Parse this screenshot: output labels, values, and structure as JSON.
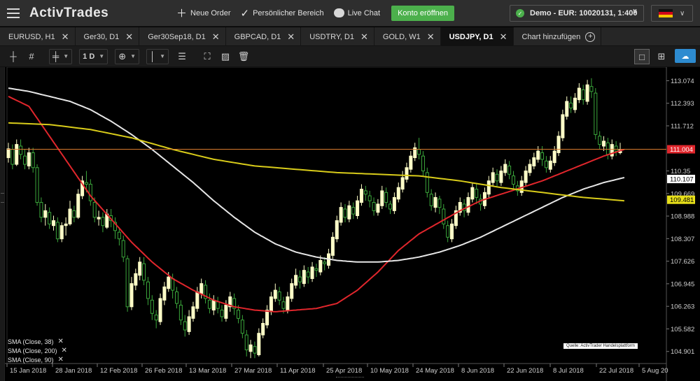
{
  "header": {
    "logo": "ActivTrades",
    "new_order": "Neue Order",
    "personal_area": "Persönlicher Bereich",
    "live_chat": "Live Chat",
    "open_account": "Konto eröffnen",
    "account": "Demo - EUR: 10020131, 1:400"
  },
  "tabs": [
    {
      "label": "EURUSD, H1"
    },
    {
      "label": "Ger30, D1"
    },
    {
      "label": "Ger30Sep18, D1"
    },
    {
      "label": "GBPCAD, D1"
    },
    {
      "label": "USDTRY, D1"
    },
    {
      "label": "GOLD, W1"
    },
    {
      "label": "USDJPY, D1"
    }
  ],
  "add_chart": "Chart hinzufügen",
  "toolbar": {
    "timeframe": "1 D"
  },
  "legend": [
    {
      "label": "SMA (Close, 38)"
    },
    {
      "label": "SMA (Close, 200)"
    },
    {
      "label": "SMA (Close, 90)"
    }
  ],
  "source": "Quelle: ActivTrader Handelsplattform",
  "colors": {
    "up": "#ffffc8",
    "down": "#3ba73b",
    "sma38": "#e0262c",
    "sma200": "#e6e6e6",
    "sma90": "#d9cc1a",
    "price_line": "#d97b2e",
    "accent": "#4cb04c"
  },
  "chart_data": {
    "type": "candlestick",
    "symbol": "USDJPY",
    "timeframe": "D1",
    "y_ticks": [
      104.901,
      105.582,
      106.263,
      106.945,
      107.626,
      108.307,
      108.988,
      109.669,
      110.35,
      111.712,
      112.393,
      113.074
    ],
    "ylim": [
      104.6,
      113.4
    ],
    "x_ticks": [
      "15 Jan 2018",
      "28 Jan 2018",
      "12 Feb 2018",
      "26 Feb 2018",
      "13 Mar 2018",
      "27 Mar 2018",
      "11 Apr 2018",
      "25 Apr 2018",
      "10 May 2018",
      "24 May 2018",
      "8 Jun 2018",
      "22 Jun 2018",
      "8 Jul 2018",
      "22 Jul 2018",
      "5 Aug 20"
    ],
    "price_labels": [
      {
        "value": 111.004,
        "text": "111.004",
        "color": "#e0262c"
      },
      {
        "value": 110.107,
        "text": "110.107",
        "color": "#ffffff"
      },
      {
        "value": 109.481,
        "text": "109.481",
        "color": "#e8e01a"
      }
    ],
    "last_price": 111.004,
    "candles": [
      [
        110.75,
        111.02,
        110.6,
        111.2
      ],
      [
        111.0,
        110.55,
        110.4,
        111.15
      ],
      [
        110.55,
        111.15,
        110.5,
        111.3
      ],
      [
        111.1,
        110.85,
        110.7,
        111.3
      ],
      [
        110.8,
        110.55,
        110.4,
        111.0
      ],
      [
        110.5,
        110.9,
        110.4,
        111.05
      ],
      [
        110.9,
        110.45,
        110.3,
        111.05
      ],
      [
        110.45,
        109.4,
        109.3,
        110.55
      ],
      [
        109.4,
        108.95,
        108.8,
        109.55
      ],
      [
        108.95,
        109.15,
        108.7,
        109.35
      ],
      [
        109.1,
        108.75,
        108.6,
        109.25
      ],
      [
        108.7,
        108.85,
        108.55,
        109.0
      ],
      [
        108.8,
        108.3,
        108.2,
        108.95
      ],
      [
        108.3,
        108.7,
        108.2,
        108.8
      ],
      [
        108.7,
        108.75,
        108.4,
        108.95
      ],
      [
        108.75,
        109.2,
        108.7,
        109.45
      ],
      [
        109.15,
        108.95,
        108.8,
        109.3
      ],
      [
        108.95,
        109.65,
        108.9,
        109.8
      ],
      [
        109.6,
        110.05,
        109.5,
        110.2
      ],
      [
        110.0,
        109.95,
        109.7,
        110.35
      ],
      [
        109.95,
        109.45,
        109.3,
        110.1
      ],
      [
        109.4,
        108.95,
        108.8,
        109.55
      ],
      [
        108.9,
        108.95,
        108.7,
        109.15
      ],
      [
        108.95,
        108.7,
        108.5,
        109.1
      ],
      [
        108.65,
        109.05,
        108.6,
        109.2
      ],
      [
        109.0,
        108.85,
        108.65,
        109.2
      ],
      [
        108.8,
        108.55,
        108.3,
        108.95
      ],
      [
        108.5,
        108.3,
        108.1,
        108.65
      ],
      [
        108.25,
        107.75,
        107.6,
        108.4
      ],
      [
        107.7,
        106.25,
        106.1,
        107.8
      ],
      [
        106.25,
        106.95,
        106.15,
        107.15
      ],
      [
        106.9,
        107.25,
        106.75,
        107.4
      ],
      [
        107.2,
        107.6,
        107.05,
        107.75
      ],
      [
        107.55,
        107.05,
        106.9,
        107.75
      ],
      [
        107.0,
        106.5,
        106.3,
        107.15
      ],
      [
        106.45,
        106.05,
        105.85,
        106.6
      ],
      [
        106.0,
        105.85,
        105.6,
        106.15
      ],
      [
        105.8,
        106.5,
        105.7,
        106.65
      ],
      [
        106.45,
        106.85,
        106.3,
        107.0
      ],
      [
        106.8,
        107.15,
        106.7,
        107.3
      ],
      [
        107.1,
        106.75,
        106.5,
        107.25
      ],
      [
        106.7,
        106.35,
        106.2,
        106.85
      ],
      [
        106.3,
        105.85,
        105.7,
        106.45
      ],
      [
        105.8,
        105.55,
        105.35,
        106.0
      ],
      [
        105.5,
        105.95,
        105.4,
        106.15
      ],
      [
        105.9,
        106.25,
        105.8,
        106.4
      ],
      [
        106.2,
        106.7,
        106.1,
        106.85
      ],
      [
        106.65,
        106.95,
        106.5,
        107.1
      ],
      [
        106.9,
        106.5,
        106.35,
        107.05
      ],
      [
        106.45,
        106.2,
        106.05,
        106.65
      ],
      [
        106.15,
        106.45,
        106.0,
        106.6
      ],
      [
        106.4,
        106.2,
        106.05,
        106.55
      ],
      [
        106.15,
        105.95,
        105.8,
        106.3
      ],
      [
        105.9,
        106.3,
        105.8,
        106.45
      ],
      [
        106.25,
        106.55,
        106.1,
        106.7
      ],
      [
        106.5,
        106.2,
        106.0,
        106.65
      ],
      [
        106.15,
        105.9,
        105.75,
        106.3
      ],
      [
        105.85,
        105.45,
        105.3,
        106.0
      ],
      [
        105.4,
        104.95,
        104.75,
        105.55
      ],
      [
        104.9,
        105.1,
        104.7,
        105.25
      ],
      [
        105.05,
        104.85,
        104.7,
        105.2
      ],
      [
        104.8,
        105.45,
        104.75,
        105.6
      ],
      [
        105.4,
        105.75,
        105.3,
        105.9
      ],
      [
        105.7,
        106.15,
        105.6,
        106.3
      ],
      [
        106.1,
        106.55,
        106.0,
        106.7
      ],
      [
        106.5,
        106.75,
        106.4,
        106.95
      ],
      [
        106.7,
        106.45,
        106.3,
        106.85
      ],
      [
        106.4,
        106.2,
        106.05,
        106.55
      ],
      [
        106.15,
        106.55,
        106.05,
        106.7
      ],
      [
        106.5,
        106.95,
        106.4,
        107.1
      ],
      [
        106.9,
        107.2,
        106.8,
        107.4
      ],
      [
        107.15,
        107.0,
        106.8,
        107.35
      ],
      [
        106.95,
        107.35,
        106.85,
        107.5
      ],
      [
        107.3,
        107.15,
        106.95,
        107.45
      ],
      [
        107.1,
        107.45,
        107.0,
        107.6
      ],
      [
        107.4,
        107.35,
        107.15,
        107.55
      ],
      [
        107.3,
        107.65,
        107.2,
        107.8
      ],
      [
        107.6,
        107.55,
        107.35,
        107.75
      ],
      [
        107.5,
        107.85,
        107.4,
        108.0
      ],
      [
        107.8,
        108.35,
        107.7,
        108.5
      ],
      [
        108.3,
        108.85,
        108.2,
        109.0
      ],
      [
        108.8,
        109.25,
        108.7,
        109.4
      ],
      [
        109.2,
        108.95,
        108.8,
        109.35
      ],
      [
        108.9,
        109.3,
        108.8,
        109.45
      ],
      [
        109.25,
        109.05,
        108.9,
        109.4
      ],
      [
        109.0,
        109.45,
        108.9,
        109.6
      ],
      [
        109.4,
        109.8,
        109.3,
        109.95
      ],
      [
        109.75,
        109.65,
        109.45,
        109.9
      ],
      [
        109.6,
        109.45,
        109.25,
        109.75
      ],
      [
        109.4,
        109.15,
        109.0,
        109.55
      ],
      [
        109.1,
        109.35,
        109.0,
        109.5
      ],
      [
        109.3,
        109.75,
        109.2,
        109.9
      ],
      [
        109.7,
        109.4,
        109.25,
        109.85
      ],
      [
        109.35,
        109.2,
        109.05,
        109.45
      ],
      [
        109.15,
        109.55,
        109.05,
        109.7
      ],
      [
        109.5,
        109.85,
        109.4,
        110.0
      ],
      [
        109.8,
        110.15,
        109.7,
        110.35
      ],
      [
        110.1,
        110.45,
        110.0,
        110.6
      ],
      [
        110.4,
        110.8,
        110.3,
        110.95
      ],
      [
        110.75,
        111.05,
        110.65,
        111.2
      ],
      [
        111.0,
        110.85,
        110.7,
        111.35
      ],
      [
        110.8,
        110.35,
        110.2,
        110.95
      ],
      [
        110.3,
        109.7,
        109.55,
        110.45
      ],
      [
        109.65,
        109.3,
        109.15,
        109.8
      ],
      [
        109.25,
        109.55,
        109.1,
        109.7
      ],
      [
        109.5,
        109.25,
        109.05,
        109.6
      ],
      [
        109.2,
        108.75,
        108.6,
        109.35
      ],
      [
        108.7,
        108.35,
        108.2,
        108.85
      ],
      [
        108.3,
        108.75,
        108.2,
        108.9
      ],
      [
        108.7,
        109.15,
        108.6,
        109.3
      ],
      [
        109.1,
        109.4,
        109.0,
        109.55
      ],
      [
        109.35,
        109.15,
        108.95,
        109.5
      ],
      [
        109.1,
        109.55,
        109.0,
        109.7
      ],
      [
        109.5,
        109.85,
        109.4,
        110.0
      ],
      [
        109.8,
        109.55,
        109.35,
        109.95
      ],
      [
        109.5,
        109.35,
        109.15,
        109.65
      ],
      [
        109.3,
        109.7,
        109.2,
        109.85
      ],
      [
        109.65,
        110.05,
        109.55,
        110.2
      ],
      [
        110.0,
        110.3,
        109.9,
        110.45
      ],
      [
        110.25,
        110.05,
        109.85,
        110.4
      ],
      [
        110.0,
        110.35,
        109.9,
        110.5
      ],
      [
        110.3,
        110.55,
        110.2,
        110.7
      ],
      [
        110.5,
        110.25,
        110.1,
        110.65
      ],
      [
        110.2,
        109.95,
        109.75,
        110.35
      ],
      [
        109.9,
        109.75,
        109.6,
        110.05
      ],
      [
        109.7,
        110.05,
        109.6,
        110.2
      ],
      [
        110.0,
        110.35,
        109.9,
        110.5
      ],
      [
        110.3,
        110.55,
        110.2,
        110.7
      ],
      [
        110.5,
        110.75,
        110.4,
        110.9
      ],
      [
        110.7,
        110.95,
        110.6,
        111.1
      ],
      [
        110.9,
        110.7,
        110.5,
        111.1
      ],
      [
        110.65,
        110.45,
        110.3,
        110.8
      ],
      [
        110.4,
        110.65,
        110.3,
        110.8
      ],
      [
        110.6,
        110.95,
        110.5,
        111.1
      ],
      [
        110.9,
        111.4,
        110.8,
        111.55
      ],
      [
        111.35,
        112.05,
        111.25,
        112.2
      ],
      [
        112.0,
        112.45,
        111.9,
        112.6
      ],
      [
        112.4,
        112.25,
        112.1,
        112.6
      ],
      [
        112.2,
        112.55,
        112.1,
        112.7
      ],
      [
        112.5,
        112.85,
        112.4,
        113.0
      ],
      [
        112.8,
        112.5,
        112.35,
        112.95
      ],
      [
        112.45,
        112.95,
        112.35,
        113.1
      ],
      [
        112.9,
        112.75,
        112.55,
        113.15
      ],
      [
        112.7,
        111.45,
        111.3,
        112.85
      ],
      [
        111.4,
        111.15,
        111.0,
        111.55
      ],
      [
        111.1,
        111.25,
        110.95,
        111.4
      ],
      [
        111.2,
        110.85,
        110.7,
        111.35
      ],
      [
        110.8,
        111.15,
        110.7,
        111.3
      ],
      [
        111.1,
        110.95,
        110.8,
        111.25
      ],
      [
        110.9,
        111.0,
        110.85,
        111.2
      ]
    ],
    "series": [
      {
        "name": "SMA (Close, 38)",
        "color": "#e0262c",
        "points": [
          [
            0,
            112.6
          ],
          [
            5,
            112.3
          ],
          [
            10,
            111.4
          ],
          [
            15,
            110.5
          ],
          [
            20,
            109.6
          ],
          [
            25,
            108.9
          ],
          [
            30,
            108.2
          ],
          [
            35,
            107.6
          ],
          [
            40,
            107.1
          ],
          [
            45,
            106.75
          ],
          [
            50,
            106.45
          ],
          [
            55,
            106.25
          ],
          [
            60,
            106.15
          ],
          [
            65,
            106.1
          ],
          [
            70,
            106.15
          ],
          [
            75,
            106.2
          ],
          [
            80,
            106.35
          ],
          [
            85,
            106.75
          ],
          [
            90,
            107.3
          ],
          [
            95,
            107.95
          ],
          [
            100,
            108.45
          ],
          [
            105,
            108.8
          ],
          [
            110,
            109.15
          ],
          [
            115,
            109.45
          ],
          [
            120,
            109.65
          ],
          [
            125,
            109.85
          ],
          [
            130,
            110.05
          ],
          [
            135,
            110.3
          ],
          [
            140,
            110.55
          ],
          [
            145,
            110.8
          ],
          [
            150,
            111.0
          ]
        ]
      },
      {
        "name": "SMA (Close, 200)",
        "color": "#e6e6e6",
        "points": [
          [
            0,
            112.85
          ],
          [
            5,
            112.75
          ],
          [
            10,
            112.6
          ],
          [
            15,
            112.45
          ],
          [
            20,
            112.2
          ],
          [
            25,
            111.85
          ],
          [
            30,
            111.45
          ],
          [
            35,
            111.0
          ],
          [
            40,
            110.5
          ],
          [
            45,
            110.0
          ],
          [
            50,
            109.45
          ],
          [
            55,
            108.95
          ],
          [
            60,
            108.5
          ],
          [
            65,
            108.15
          ],
          [
            70,
            107.9
          ],
          [
            75,
            107.75
          ],
          [
            80,
            107.65
          ],
          [
            85,
            107.6
          ],
          [
            90,
            107.6
          ],
          [
            95,
            107.65
          ],
          [
            100,
            107.75
          ],
          [
            105,
            107.9
          ],
          [
            110,
            108.1
          ],
          [
            115,
            108.35
          ],
          [
            120,
            108.65
          ],
          [
            125,
            108.95
          ],
          [
            130,
            109.25
          ],
          [
            135,
            109.55
          ],
          [
            140,
            109.8
          ],
          [
            145,
            110.0
          ],
          [
            150,
            110.15
          ]
        ]
      },
      {
        "name": "SMA (Close, 90)",
        "color": "#d9cc1a",
        "points": [
          [
            0,
            111.8
          ],
          [
            10,
            111.75
          ],
          [
            20,
            111.6
          ],
          [
            30,
            111.35
          ],
          [
            40,
            111.0
          ],
          [
            50,
            110.7
          ],
          [
            60,
            110.5
          ],
          [
            70,
            110.4
          ],
          [
            80,
            110.3
          ],
          [
            90,
            110.25
          ],
          [
            100,
            110.2
          ],
          [
            110,
            110.05
          ],
          [
            120,
            109.85
          ],
          [
            130,
            109.7
          ],
          [
            140,
            109.55
          ],
          [
            150,
            109.45
          ]
        ]
      }
    ]
  }
}
